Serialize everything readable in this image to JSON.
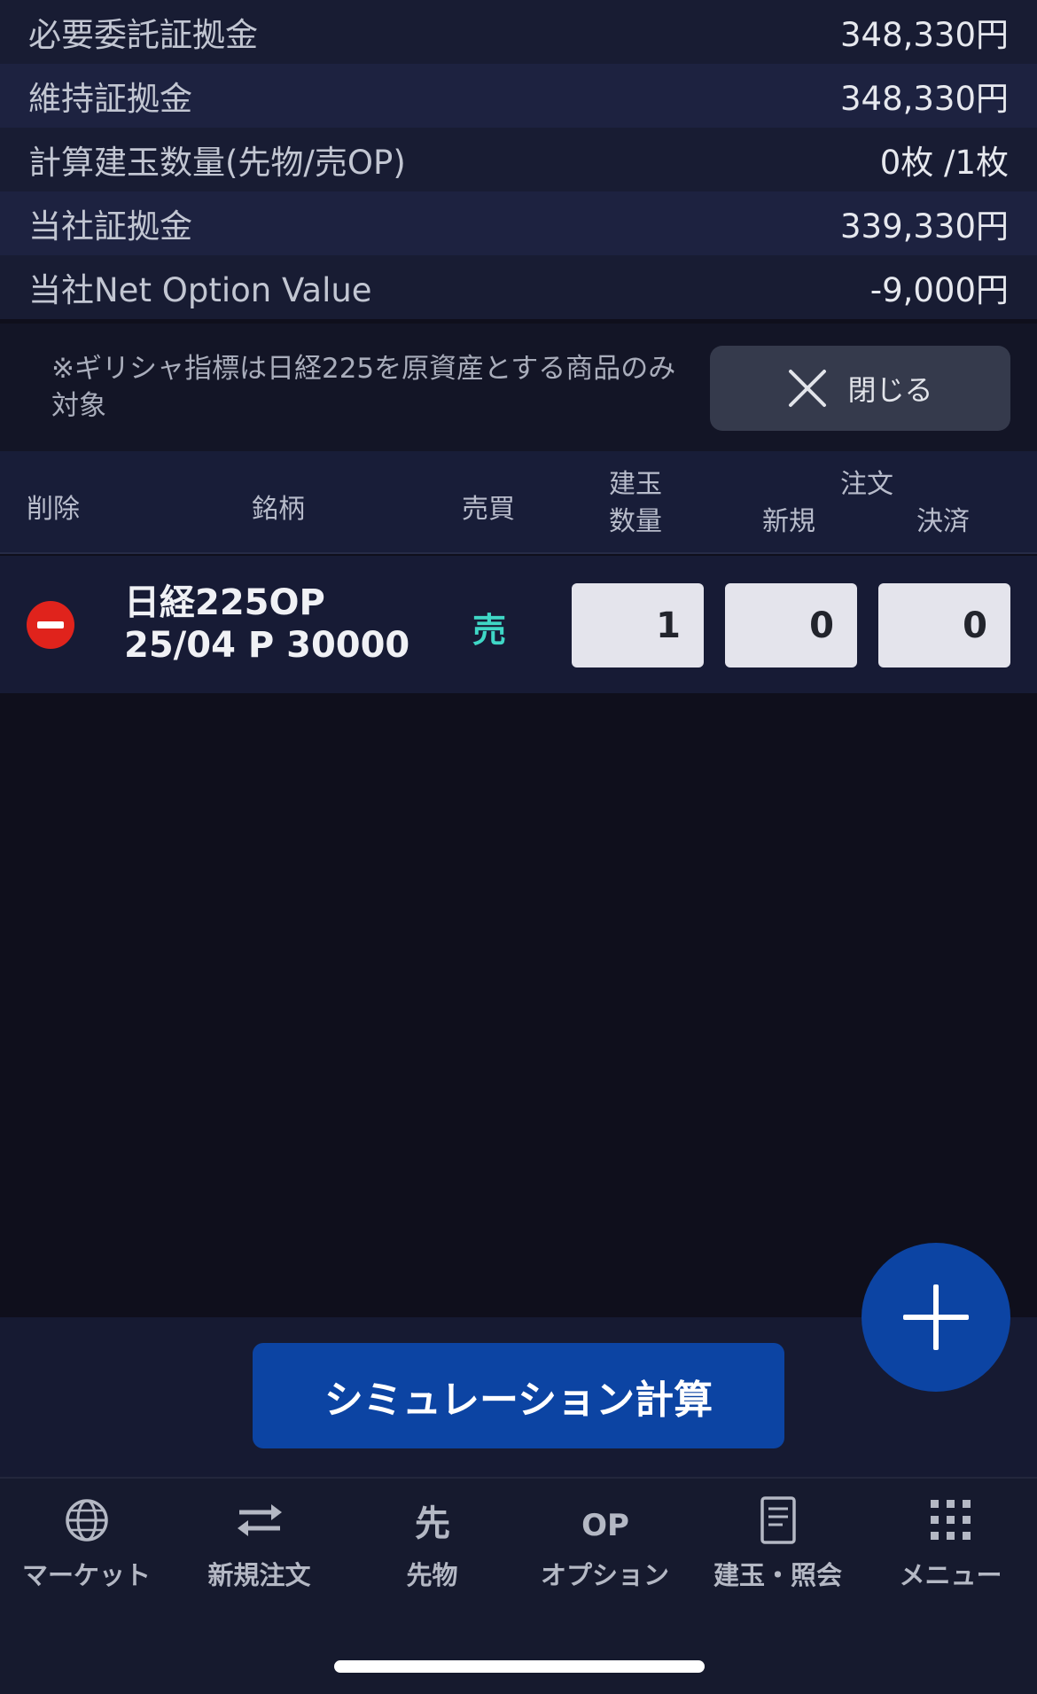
{
  "summary": [
    {
      "label": "必要委託証拠金",
      "value": "348,330円"
    },
    {
      "label": "維持証拠金",
      "value": "348,330円"
    },
    {
      "label": "計算建玉数量(先物/売OP)",
      "value": "0枚 /1枚"
    },
    {
      "label": "当社証拠金",
      "value": "339,330円"
    },
    {
      "label": "当社Net Option Value",
      "value": "-9,000円"
    }
  ],
  "note": {
    "text": "※ギリシャ指標は日経225を原資産とする商品のみ対象",
    "close_label": "閉じる"
  },
  "table": {
    "headers": {
      "delete": "削除",
      "symbol": "銘柄",
      "side": "売買",
      "position_qty_1": "建玉",
      "position_qty_2": "数量",
      "order": "注文",
      "new": "新規",
      "settle": "決済"
    },
    "rows": [
      {
        "symbol_line1": "日経225OP",
        "symbol_line2": "25/04 P 30000",
        "side": "売",
        "position_qty": "1",
        "new_qty": "0",
        "settle_qty": "0"
      }
    ]
  },
  "simulate_label": "シミュレーション計算",
  "nav": [
    {
      "label": "マーケット",
      "icon": "globe-icon"
    },
    {
      "label": "新規注文",
      "icon": "swap-arrows-icon"
    },
    {
      "label": "先物",
      "icon": "futures-icon"
    },
    {
      "label": "オプション",
      "icon": "option-icon"
    },
    {
      "label": "建玉・照会",
      "icon": "document-icon"
    },
    {
      "label": "メニュー",
      "icon": "grid-menu-icon"
    }
  ],
  "colors": {
    "accent_blue": "#0c44a3",
    "sell_teal": "#3fd7c6",
    "delete_red": "#e0231c"
  }
}
